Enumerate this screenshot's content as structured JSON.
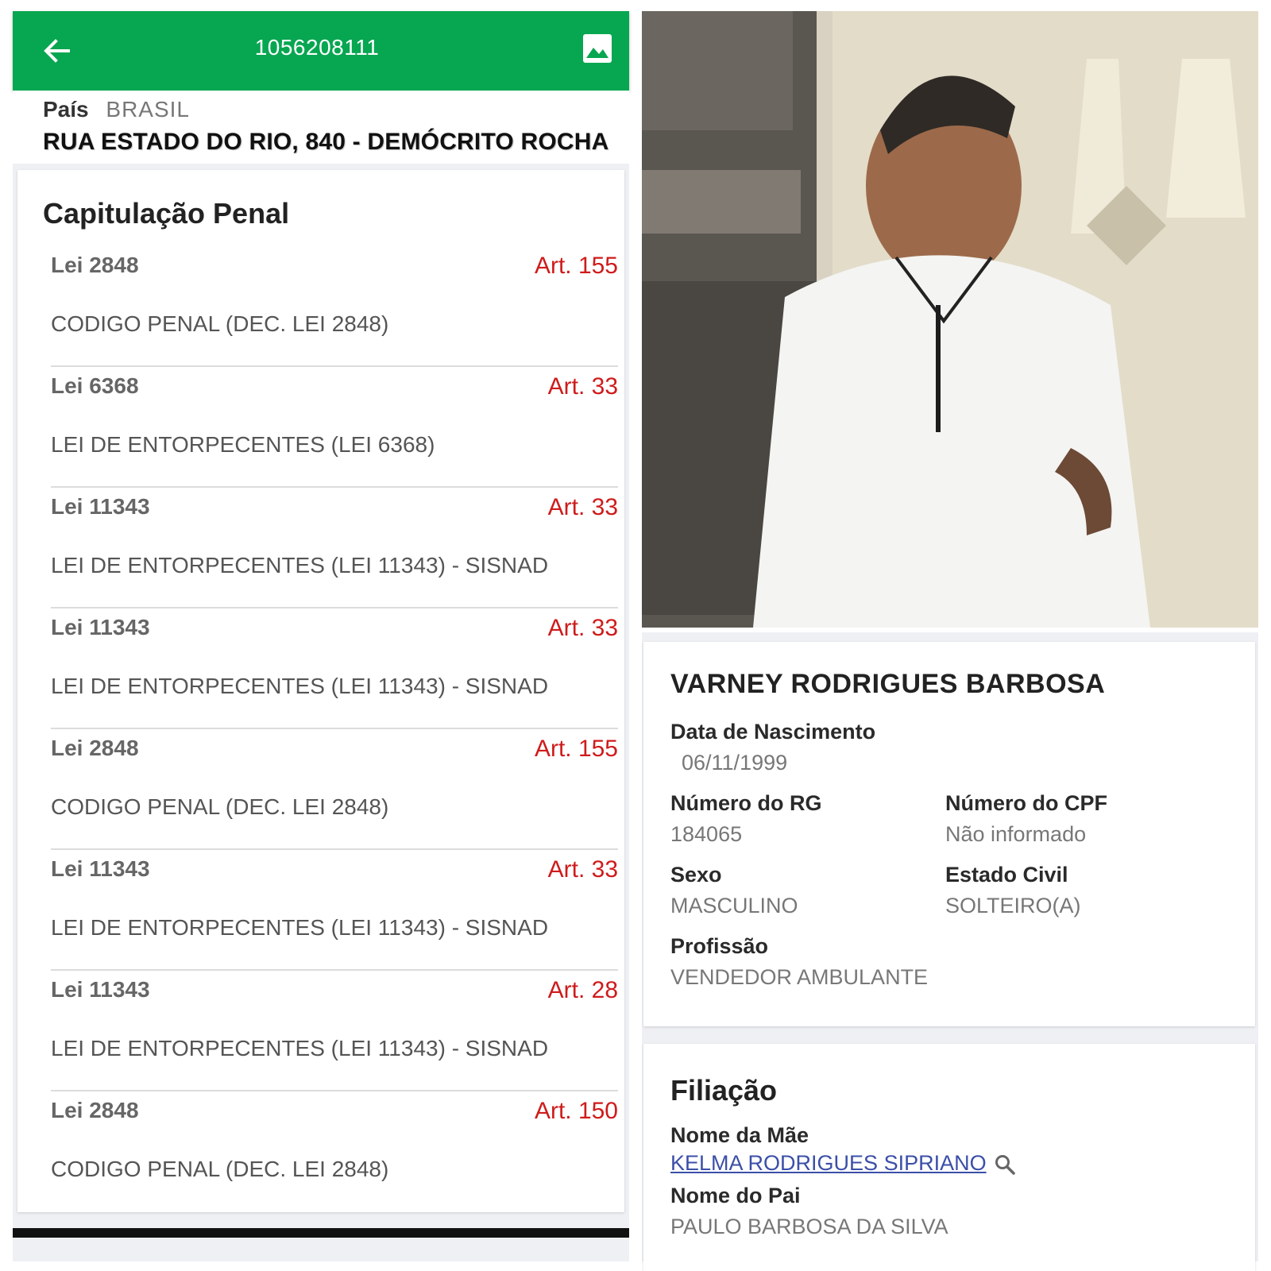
{
  "header": {
    "record_number": "1056208111",
    "back_icon": "arrow-left-icon",
    "image_icon": "image-icon",
    "bar_color": "#07a651"
  },
  "address": {
    "country_label": "País",
    "country_value": "BRASIL",
    "street": "RUA ESTADO DO RIO, 840 - DEMÓCRITO ROCHA"
  },
  "penal": {
    "title": "Capitulação Penal",
    "items": [
      {
        "law": "Lei 2848",
        "article": "Art. 155",
        "description": "CODIGO PENAL (DEC. LEI 2848)"
      },
      {
        "law": "Lei 6368",
        "article": "Art. 33",
        "description": "LEI DE ENTORPECENTES (LEI 6368)"
      },
      {
        "law": "Lei 11343",
        "article": "Art. 33",
        "description": "LEI DE ENTORPECENTES (LEI 11343) - SISNAD"
      },
      {
        "law": "Lei 11343",
        "article": "Art. 33",
        "description": "LEI DE ENTORPECENTES (LEI 11343) - SISNAD"
      },
      {
        "law": "Lei 2848",
        "article": "Art. 155",
        "description": "CODIGO PENAL (DEC. LEI 2848)"
      },
      {
        "law": "Lei 11343",
        "article": "Art. 33",
        "description": "LEI DE ENTORPECENTES (LEI 11343) - SISNAD"
      },
      {
        "law": "Lei 11343",
        "article": "Art. 28",
        "description": "LEI DE ENTORPECENTES (LEI 11343) - SISNAD"
      },
      {
        "law": "Lei 2848",
        "article": "Art. 150",
        "description": "CODIGO PENAL (DEC. LEI 2848)"
      }
    ],
    "article_color": "#cf1b1b"
  },
  "person": {
    "name": "VARNEY RODRIGUES BARBOSA",
    "birth_label": "Data de Nascimento",
    "birth_value": "06/11/1999",
    "rg_label": "Número do RG",
    "rg_value": "184065",
    "cpf_label": "Número do CPF",
    "cpf_value": "Não informado",
    "sex_label": "Sexo",
    "sex_value": "MASCULINO",
    "civil_label": "Estado Civil",
    "civil_value": "SOLTEIRO(A)",
    "job_label": "Profissão",
    "job_value": "VENDEDOR AMBULANTE"
  },
  "filiation": {
    "title": "Filiação",
    "mother_label": "Nome da Mãe",
    "mother_value": "KELMA RODRIGUES SIPRIANO",
    "mother_search_icon": "search-icon",
    "father_label": "Nome do Pai",
    "father_value": "PAULO BARBOSA DA SILVA"
  }
}
